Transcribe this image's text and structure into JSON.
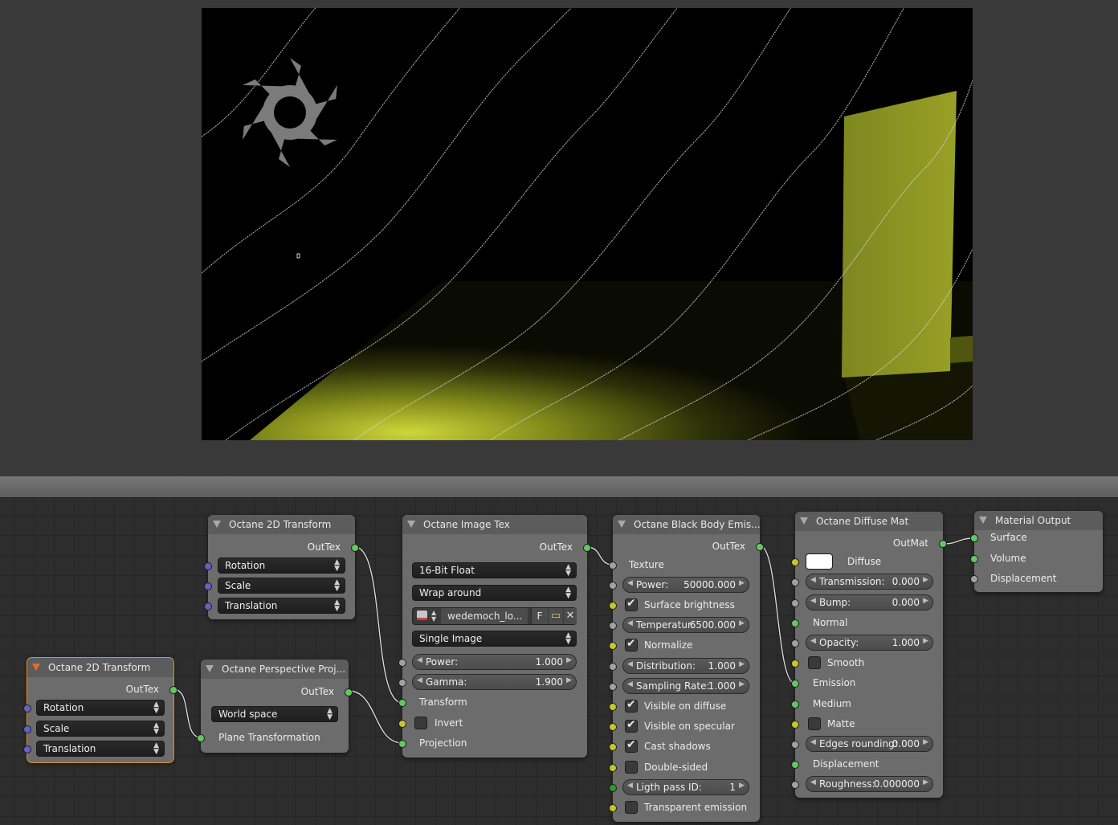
{
  "nodes": {
    "transform_top": {
      "title": "Octane 2D Transform",
      "out": "OutTex",
      "inputs": [
        "Rotation",
        "Scale",
        "Translation"
      ]
    },
    "transform_bottom": {
      "title": "Octane 2D Transform",
      "out": "OutTex",
      "inputs": [
        "Rotation",
        "Scale",
        "Translation"
      ]
    },
    "perspective": {
      "title": "Octane Perspective Proj...",
      "out": "OutTex",
      "space": "World space",
      "input": "Plane Transformation"
    },
    "image_tex": {
      "title": "Octane Image Tex",
      "out": "OutTex",
      "format": "16-Bit Float",
      "wrap": "Wrap around",
      "image_name": "wedemoch_lo...",
      "fake_user": "F",
      "source": "Single Image",
      "power_label": "Power:",
      "power_value": "1.000",
      "gamma_label": "Gamma:",
      "gamma_value": "1.900",
      "transform": "Transform",
      "invert": "Invert",
      "projection": "Projection"
    },
    "blackbody": {
      "title": "Octane Black Body Emis...",
      "out": "OutTex",
      "texture": "Texture",
      "power_label": "Power:",
      "power_value": "50000.000",
      "surface_brightness": "Surface brightness",
      "temp_label": "Temperatur:",
      "temp_value": "6500.000",
      "normalize": "Normalize",
      "dist_label": "Distribution:",
      "dist_value": "1.000",
      "sampling_label": "Sampling Rate:",
      "sampling_value": "1.000",
      "visible_diffuse": "Visible on diffuse",
      "visible_specular": "Visible on specular",
      "cast_shadows": "Cast shadows",
      "double_sided": "Double-sided",
      "pass_label": "Ligth pass ID:",
      "pass_value": "1",
      "transparent_emission": "Transparent emission"
    },
    "diffuse": {
      "title": "Octane Diffuse Mat",
      "out": "OutMat",
      "diffuse": "Diffuse",
      "diffuse_color": "#ffffff",
      "trans_label": "Transmission:",
      "trans_value": "0.000",
      "bump_label": "Bump:",
      "bump_value": "0.000",
      "normal": "Normal",
      "opacity_label": "Opacity:",
      "opacity_value": "1.000",
      "smooth": "Smooth",
      "emission": "Emission",
      "medium": "Medium",
      "matte": "Matte",
      "edges_label": "Edges rounding:",
      "edges_value": "0.000",
      "displacement": "Displacement",
      "rough_label": "Roughness:",
      "rough_value": "0.000000"
    },
    "output": {
      "title": "Material Output",
      "inputs": [
        "Surface",
        "Volume",
        "Displacement"
      ]
    }
  },
  "colors": {
    "render_floor": "#b8c23a",
    "socket_green": "#63c763",
    "socket_blue": "#6363c7",
    "socket_yellow": "#c7c729",
    "socket_gray": "#a2a2a2",
    "selected_outline": "#e2902c"
  },
  "icons": [
    "image-icon",
    "folder-icon",
    "close-icon",
    "collapse-triangle-icon",
    "octane-logo"
  ]
}
